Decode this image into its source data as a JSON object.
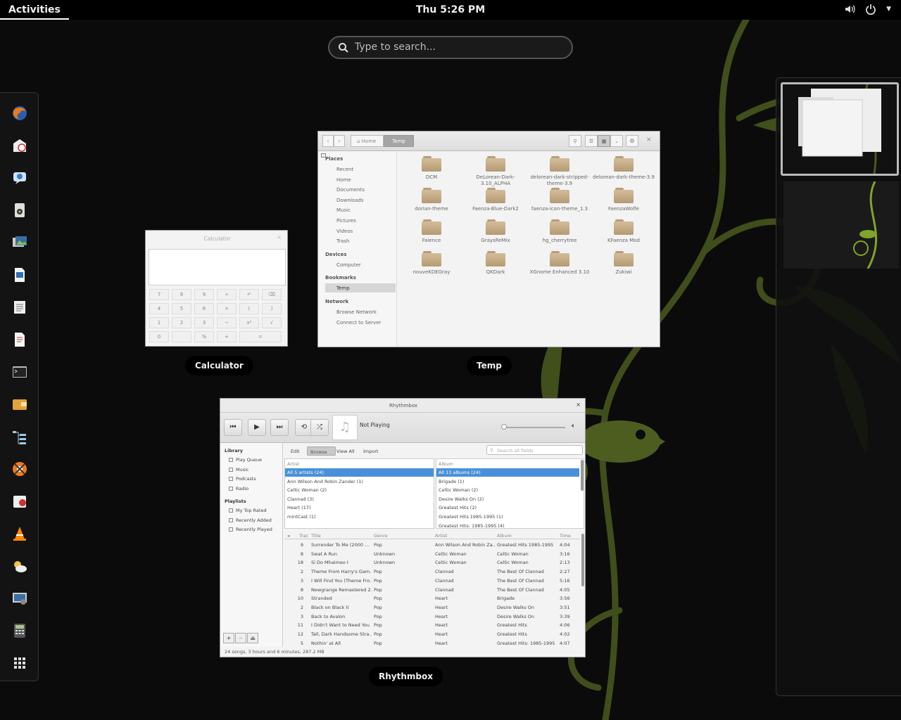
{
  "topbar": {
    "activities": "Activities",
    "clock": "Thu  5:26 PM"
  },
  "search": {
    "placeholder": "Type to search..."
  },
  "dash": {
    "apps": [
      "firefox-icon",
      "evolution-icon",
      "empathy-icon",
      "audio-speaker-icon",
      "photos-icon",
      "writer-icon",
      "document-viewer-icon",
      "text-editor-icon",
      "terminal-icon",
      "wallet-icon",
      "hierarchy-icon",
      "lifesaver-icon",
      "software-icon",
      "vlc-icon",
      "weather-icon",
      "system-settings-icon",
      "calculator-icon",
      "app-grid-icon"
    ]
  },
  "windows": {
    "calculator": {
      "title": "Calculator",
      "label": "Calculator",
      "keys": [
        [
          "7",
          "8",
          "9",
          "÷",
          "↶",
          "⌫"
        ],
        [
          "4",
          "5",
          "6",
          "×",
          "(",
          ")"
        ],
        [
          "1",
          "2",
          "3",
          "−",
          "x²",
          "√"
        ],
        [
          "0",
          "",
          "%",
          "+",
          "="
        ]
      ]
    },
    "temp": {
      "label": "Temp",
      "path": [
        "Home",
        "Temp"
      ],
      "places_header": "Places",
      "places": [
        "Recent",
        "Home",
        "Documents",
        "Downloads",
        "Music",
        "Pictures",
        "Videos",
        "Trash"
      ],
      "devices_header": "Devices",
      "devices": [
        "Computer"
      ],
      "bookmarks_header": "Bookmarks",
      "bookmarks": [
        "Temp"
      ],
      "network_header": "Network",
      "network": [
        "Browse Network",
        "Connect to Server"
      ],
      "folders": [
        "DCM",
        "DeLorean-Dark-3.10_ALPHA",
        "delorean-dark-stripped-theme-3.9",
        "delorean-dark-theme-3.9",
        "dorian-theme",
        "Faenza-Blue-Dark2",
        "faenza-icon-theme_1.3",
        "FaenzaWolfe",
        "Faience",
        "GraysReMix",
        "hg_cherrytree",
        "KFaenza Mod",
        "nouveKDEGray",
        "QKDark",
        "XGnome Enhanced 3.10",
        "Zukiwi"
      ]
    },
    "rhythmbox": {
      "title": "Rhythmbox",
      "label": "Rhythmbox",
      "now_playing": "Not Playing",
      "library_header": "Library",
      "library": [
        "Play Queue",
        "Music",
        "Podcasts",
        "Radio"
      ],
      "playlists_header": "Playlists",
      "playlists": [
        "My Top Rated",
        "Recently Added",
        "Recently Played"
      ],
      "tabs": [
        "Edit",
        "Browse",
        "View All",
        "Import"
      ],
      "search_placeholder": "Search all fields",
      "artist_header": "Artist",
      "artists": [
        "All 5 artists (24)",
        "Ann Wilson And Robin Zander (1)",
        "Celtic Woman (2)",
        "Clannad (3)",
        "Heart (17)",
        "mintCast (1)"
      ],
      "album_header": "Album",
      "albums": [
        "All 13 albums (24)",
        "Brigade (1)",
        "Celtic Woman (2)",
        "Desire Walks On (2)",
        "Greatest Hits (2)",
        "Greatest Hits 1985-1995 (1)",
        "Greatest Hits: 1985-1995 (4)"
      ],
      "columns": [
        "Trac",
        "Title",
        "Genre",
        "Artist",
        "Album",
        "Time"
      ],
      "tracks": [
        [
          "9",
          "Surrender To Me (2000 ...",
          "Pop",
          "Ann Wilson And Robin Za...",
          "Greatest Hits 1985-1995",
          "4:04"
        ],
        [
          "8",
          "Swat A Run",
          "Unknown",
          "Celtic Woman",
          "Celtic Woman",
          "3:16"
        ],
        [
          "18",
          "Si Do Mhaimeo I",
          "Unknown",
          "Celtic Woman",
          "Celtic Woman",
          "2:13"
        ],
        [
          "2",
          "Theme From Harry's Gam...",
          "Pop",
          "Clannad",
          "The Best Of Clannad",
          "2:27"
        ],
        [
          "3",
          "I Will Find You (Theme Fro...",
          "Pop",
          "Clannad",
          "The Best Of Clannad",
          "5:16"
        ],
        [
          "8",
          "Newgrange Remastered 2...",
          "Pop",
          "Clannad",
          "The Best Of Clannad",
          "4:05"
        ],
        [
          "10",
          "Stranded",
          "Pop",
          "Heart",
          "Brigade",
          "3:56"
        ],
        [
          "2",
          "Black on Black II",
          "Pop",
          "Heart",
          "Desire Walks On",
          "3:51"
        ],
        [
          "3",
          "Back to Avalon",
          "Pop",
          "Heart",
          "Desire Walks On",
          "3:39"
        ],
        [
          "11",
          "I Didn't Want to Need You",
          "Pop",
          "Heart",
          "Greatest Hits",
          "4:06"
        ],
        [
          "12",
          "Tall, Dark Handsome Stra...",
          "Pop",
          "Heart",
          "Greatest Hits",
          "4:02"
        ],
        [
          "5",
          "Nothin' at All",
          "Pop",
          "Heart",
          "Greatest Hits: 1985-1995",
          "4:07"
        ]
      ],
      "status": "24 songs, 3 hours and 6 minutes, 287.2 MB",
      "bottom_buttons": [
        "+",
        "−",
        "⏏"
      ]
    }
  }
}
